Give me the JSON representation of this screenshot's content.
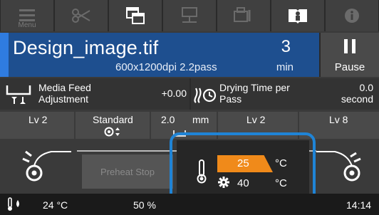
{
  "toolbar": {
    "menu_label": "Menu",
    "buttons": [
      "menu-icon",
      "scissors-icon",
      "copy-windows-icon",
      "network-icon",
      "printer-settings-icon",
      "book-icon",
      "info-icon"
    ]
  },
  "job": {
    "file_name": "Design_image.tif",
    "resolution": "600x1200dpi 2.2pass",
    "remaining_time": "3",
    "time_unit": "min"
  },
  "pause": {
    "label": "Pause"
  },
  "media_feed": {
    "label_line1": "Media Feed",
    "label_line2": "Adjustment",
    "value": "+0.00"
  },
  "drying_time": {
    "label_line1": "Drying Time per",
    "label_line2": "Pass",
    "value": "0.0",
    "unit": "second"
  },
  "settings": {
    "left_level": "Lv 2",
    "mode": "Standard",
    "gap_value": "2.0",
    "gap_unit": "mm",
    "mid_level": "Lv 2",
    "right_level": "Lv 8"
  },
  "preheat": {
    "label": "Preheat Stop"
  },
  "heater": {
    "set_temp": "25",
    "set_unit": "°C",
    "current_temp": "40",
    "current_unit": "°C",
    "accent": "#f08a1a"
  },
  "status": {
    "temperature": "24 °C",
    "humidity": "50 %",
    "clock": "14:14"
  }
}
